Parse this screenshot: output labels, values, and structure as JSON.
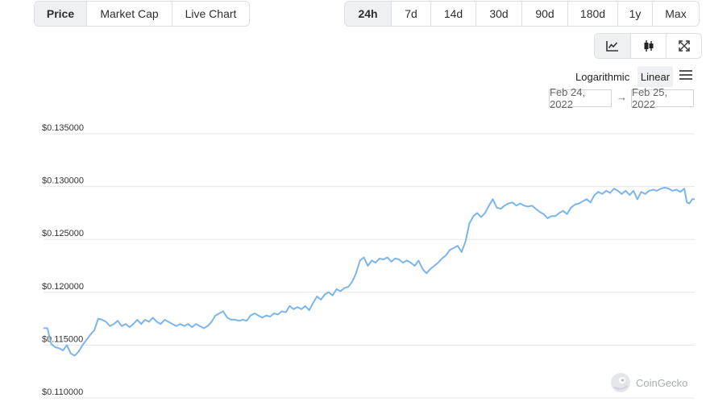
{
  "metric_tabs": [
    {
      "label": "Price",
      "active": true
    },
    {
      "label": "Market Cap",
      "active": false
    },
    {
      "label": "Live Chart",
      "active": false
    }
  ],
  "range_tabs": [
    {
      "label": "24h",
      "active": true
    },
    {
      "label": "7d",
      "active": false
    },
    {
      "label": "14d",
      "active": false
    },
    {
      "label": "30d",
      "active": false
    },
    {
      "label": "90d",
      "active": false
    },
    {
      "label": "180d",
      "active": false
    },
    {
      "label": "1y",
      "active": false
    },
    {
      "label": "Max",
      "active": false
    }
  ],
  "view_tabs": [
    {
      "icon": "line-chart-icon",
      "active": true
    },
    {
      "icon": "candlestick-icon",
      "active": false
    },
    {
      "icon": "fullscreen-icon",
      "active": false
    }
  ],
  "scale": {
    "logarithmic": "Logarithmic",
    "linear": "Linear",
    "selected": "Linear"
  },
  "date_range": {
    "from": "Feb 24, 2022",
    "arrow": "→",
    "to": "Feb 25, 2022"
  },
  "watermark": "CoinGecko",
  "colors": {
    "line": "#7cb5ec",
    "grid": "#e6e6e6",
    "active_tab": "#eef0f3"
  },
  "chart_data": {
    "type": "line",
    "ylim": [
      0.11,
      0.135
    ],
    "y_ticks": [
      "$0.135000",
      "$0.130000",
      "$0.125000",
      "$0.120000",
      "$0.115000",
      "$0.110000"
    ],
    "y_tick_values": [
      0.135,
      0.13,
      0.125,
      0.12,
      0.115,
      0.11
    ],
    "x_range": [
      0,
      100
    ],
    "series": [
      {
        "points": [
          [
            0,
            0.1166
          ],
          [
            0.6,
            0.1166
          ],
          [
            1.2,
            0.1151
          ],
          [
            1.8,
            0.1148
          ],
          [
            2.4,
            0.1147
          ],
          [
            3.0,
            0.1145
          ],
          [
            3.6,
            0.115
          ],
          [
            4.2,
            0.1142
          ],
          [
            4.8,
            0.114
          ],
          [
            5.4,
            0.1144
          ],
          [
            6.0,
            0.115
          ],
          [
            6.6,
            0.1155
          ],
          [
            7.2,
            0.116
          ],
          [
            7.8,
            0.1164
          ],
          [
            8.4,
            0.1175
          ],
          [
            9.0,
            0.1174
          ],
          [
            9.6,
            0.1172
          ],
          [
            10.2,
            0.1168
          ],
          [
            10.8,
            0.117
          ],
          [
            11.4,
            0.1173
          ],
          [
            12.0,
            0.1168
          ],
          [
            12.6,
            0.117
          ],
          [
            13.2,
            0.1167
          ],
          [
            13.8,
            0.117
          ],
          [
            14.4,
            0.1174
          ],
          [
            15.0,
            0.117
          ],
          [
            15.6,
            0.1174
          ],
          [
            16.2,
            0.1172
          ],
          [
            16.8,
            0.1176
          ],
          [
            17.4,
            0.1172
          ],
          [
            18.0,
            0.117
          ],
          [
            18.6,
            0.1174
          ],
          [
            19.2,
            0.1172
          ],
          [
            19.8,
            0.117
          ],
          [
            20.4,
            0.1168
          ],
          [
            21.0,
            0.117
          ],
          [
            21.6,
            0.1168
          ],
          [
            22.2,
            0.117
          ],
          [
            22.8,
            0.1167
          ],
          [
            23.4,
            0.117
          ],
          [
            24.0,
            0.1168
          ],
          [
            24.6,
            0.1166
          ],
          [
            25.2,
            0.1168
          ],
          [
            25.8,
            0.1172
          ],
          [
            26.4,
            0.1178
          ],
          [
            27.0,
            0.118
          ],
          [
            27.6,
            0.1182
          ],
          [
            28.2,
            0.1176
          ],
          [
            28.8,
            0.1174
          ],
          [
            29.4,
            0.1174
          ],
          [
            30.0,
            0.1173
          ],
          [
            30.6,
            0.1174
          ],
          [
            31.2,
            0.1173
          ],
          [
            31.8,
            0.1178
          ],
          [
            32.4,
            0.118
          ],
          [
            33.0,
            0.1178
          ],
          [
            33.6,
            0.1176
          ],
          [
            34.2,
            0.1178
          ],
          [
            34.8,
            0.1177
          ],
          [
            35.4,
            0.118
          ],
          [
            36.0,
            0.1179
          ],
          [
            36.6,
            0.1182
          ],
          [
            37.2,
            0.1181
          ],
          [
            37.8,
            0.1187
          ],
          [
            38.4,
            0.1184
          ],
          [
            39.0,
            0.1186
          ],
          [
            39.6,
            0.1184
          ],
          [
            40.2,
            0.1187
          ],
          [
            40.8,
            0.1183
          ],
          [
            41.4,
            0.119
          ],
          [
            42.0,
            0.1196
          ],
          [
            42.6,
            0.1193
          ],
          [
            43.2,
            0.1198
          ],
          [
            43.8,
            0.12
          ],
          [
            44.4,
            0.1197
          ],
          [
            45.0,
            0.1203
          ],
          [
            45.6,
            0.1201
          ],
          [
            46.2,
            0.1204
          ],
          [
            46.8,
            0.1205
          ],
          [
            47.4,
            0.121
          ],
          [
            48.0,
            0.1218
          ],
          [
            48.6,
            0.123
          ],
          [
            49.2,
            0.1233
          ],
          [
            49.8,
            0.1225
          ],
          [
            50.4,
            0.123
          ],
          [
            51.0,
            0.1228
          ],
          [
            51.6,
            0.1232
          ],
          [
            52.2,
            0.1231
          ],
          [
            52.8,
            0.1233
          ],
          [
            53.4,
            0.1229
          ],
          [
            54.0,
            0.1232
          ],
          [
            54.6,
            0.1231
          ],
          [
            55.2,
            0.1228
          ],
          [
            55.8,
            0.123
          ],
          [
            56.4,
            0.1228
          ],
          [
            57.0,
            0.1225
          ],
          [
            57.6,
            0.123
          ],
          [
            58.2,
            0.1222
          ],
          [
            58.8,
            0.1218
          ],
          [
            59.4,
            0.1222
          ],
          [
            60.0,
            0.1225
          ],
          [
            60.6,
            0.1228
          ],
          [
            61.2,
            0.1232
          ],
          [
            61.8,
            0.1235
          ],
          [
            62.4,
            0.124
          ],
          [
            63.0,
            0.1242
          ],
          [
            63.6,
            0.1244
          ],
          [
            64.2,
            0.1238
          ],
          [
            64.8,
            0.1248
          ],
          [
            65.4,
            0.1265
          ],
          [
            66.0,
            0.1272
          ],
          [
            66.6,
            0.1275
          ],
          [
            67.2,
            0.1271
          ],
          [
            67.8,
            0.1275
          ],
          [
            68.4,
            0.1282
          ],
          [
            69.0,
            0.1288
          ],
          [
            69.6,
            0.128
          ],
          [
            70.2,
            0.1279
          ],
          [
            70.8,
            0.1282
          ],
          [
            71.4,
            0.1284
          ],
          [
            72.0,
            0.1285
          ],
          [
            72.6,
            0.1282
          ],
          [
            73.2,
            0.1284
          ],
          [
            73.8,
            0.1282
          ],
          [
            74.4,
            0.1281
          ],
          [
            75.0,
            0.1282
          ],
          [
            75.6,
            0.1279
          ],
          [
            76.2,
            0.1276
          ],
          [
            76.8,
            0.1274
          ],
          [
            77.4,
            0.127
          ],
          [
            78.0,
            0.1272
          ],
          [
            78.6,
            0.1272
          ],
          [
            79.2,
            0.1275
          ],
          [
            79.8,
            0.1277
          ],
          [
            80.4,
            0.1274
          ],
          [
            81.0,
            0.128
          ],
          [
            81.6,
            0.1283
          ],
          [
            82.2,
            0.1284
          ],
          [
            82.8,
            0.1286
          ],
          [
            83.4,
            0.1288
          ],
          [
            84.0,
            0.1285
          ],
          [
            84.6,
            0.1292
          ],
          [
            85.2,
            0.1295
          ],
          [
            85.8,
            0.1293
          ],
          [
            86.4,
            0.1296
          ],
          [
            87.0,
            0.1294
          ],
          [
            87.6,
            0.1298
          ],
          [
            88.2,
            0.1296
          ],
          [
            88.8,
            0.1293
          ],
          [
            89.4,
            0.1296
          ],
          [
            90.0,
            0.1292
          ],
          [
            90.6,
            0.1296
          ],
          [
            91.2,
            0.1288
          ],
          [
            91.8,
            0.1295
          ],
          [
            92.4,
            0.1293
          ],
          [
            93.0,
            0.1296
          ],
          [
            93.6,
            0.1297
          ],
          [
            94.2,
            0.1296
          ],
          [
            94.8,
            0.1298
          ],
          [
            95.4,
            0.1299
          ],
          [
            96.0,
            0.1298
          ],
          [
            96.6,
            0.1296
          ],
          [
            97.2,
            0.1297
          ],
          [
            97.8,
            0.1295
          ],
          [
            98.4,
            0.1298
          ],
          [
            98.8,
            0.1285
          ],
          [
            99.2,
            0.1284
          ],
          [
            99.6,
            0.1288
          ],
          [
            100,
            0.1288
          ]
        ]
      }
    ]
  }
}
